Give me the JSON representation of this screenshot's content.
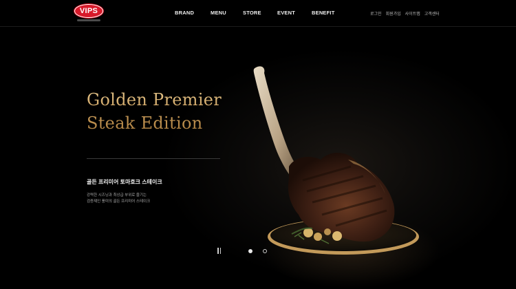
{
  "header": {
    "logo": {
      "text": "VIPS"
    },
    "nav": [
      "BRAND",
      "MENU",
      "STORE",
      "EVENT",
      "BENEFIT"
    ],
    "util": [
      "로그인",
      "회원가입",
      "사이트맵",
      "고객센터"
    ]
  },
  "hero": {
    "headline_line1": "Golden Premier",
    "headline_line2": "Steak Edition",
    "product_name": "골든 프리미어 토마호크 스테이크",
    "desc_line1": "강력한 시즈닝과 최상급 부위로 즐기는",
    "desc_line2": "검증제인 풍미의 골든 프리미어 스테이크",
    "slides": {
      "count": 2,
      "active": 1
    }
  },
  "colors": {
    "brand_red": "#d7192a",
    "gold": "#c79a59",
    "background": "#000000"
  },
  "icons": [
    "pause-icon",
    "slide-dot-active",
    "slide-dot-inactive"
  ]
}
